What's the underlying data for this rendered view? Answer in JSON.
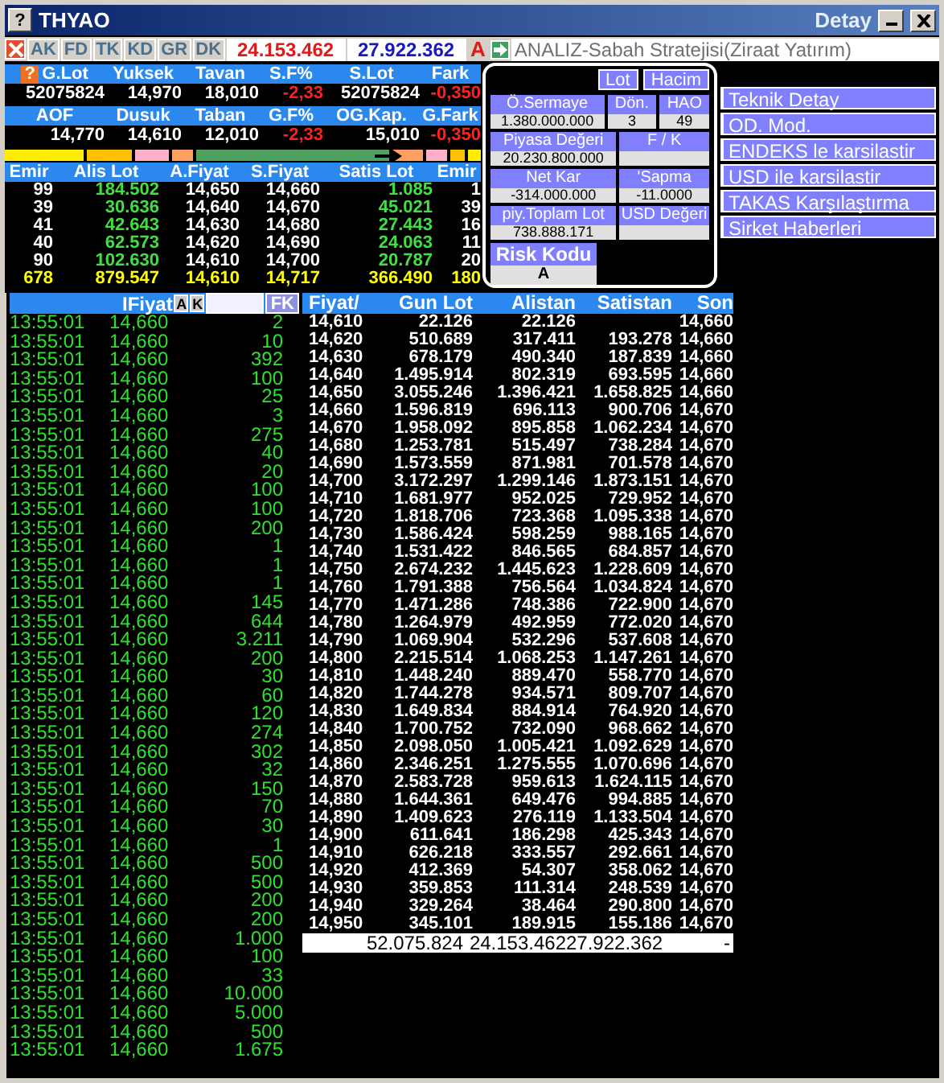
{
  "window": {
    "help": "?",
    "title": "THYAO",
    "caption": "Detay"
  },
  "summary_help": "?",
  "toolbar": {
    "tabs": [
      "AK",
      "FD",
      "TK",
      "KD",
      "GR",
      "DK"
    ],
    "bid_total": "24.153.462",
    "ask_total": "27.922.362",
    "flag": "A",
    "news": "ANALIZ-Sabah Stratejisi(Ziraat Yatırım)"
  },
  "summary": [
    {
      "labels": [
        "G.Lot",
        "Yuksek",
        "Tavan",
        "S.F%",
        "S.Lot",
        "Fark"
      ],
      "values": [
        {
          "text": "52075824",
          "negative": false
        },
        {
          "text": "14,970",
          "negative": false
        },
        {
          "text": "18,010",
          "negative": false
        },
        {
          "text": "-2,33",
          "negative": true
        },
        {
          "text": "52075824",
          "negative": false
        },
        {
          "text": "-0,350",
          "negative": true
        }
      ]
    },
    {
      "labels": [
        "AOF",
        "Dusuk",
        "Taban",
        "G.F%",
        "OG.Kap.",
        "G.Fark"
      ],
      "values": [
        {
          "text": "14,770",
          "negative": false
        },
        {
          "text": "14,610",
          "negative": false
        },
        {
          "text": "12,010",
          "negative": false
        },
        {
          "text": "-2,33",
          "negative": true
        },
        {
          "text": "15,010",
          "negative": false
        },
        {
          "text": "-0,350",
          "negative": true
        }
      ]
    }
  ],
  "depth": {
    "columns": [
      "Emir",
      "Alis Lot",
      "A.Fiyat",
      "S.Fiyat",
      "Satis Lot",
      "Emir"
    ],
    "rows": [
      [
        "99",
        "184.502",
        "14,650",
        "14,660",
        "1.085",
        "1"
      ],
      [
        "39",
        "30.636",
        "14,640",
        "14,670",
        "45.021",
        "39"
      ],
      [
        "41",
        "42.643",
        "14,630",
        "14,680",
        "27.443",
        "16"
      ],
      [
        "40",
        "62.573",
        "14,620",
        "14,690",
        "24.063",
        "11"
      ],
      [
        "90",
        "102.630",
        "14,610",
        "14,700",
        "20.787",
        "20"
      ]
    ],
    "total": [
      "678",
      "879.547",
      "14,610",
      "14,717",
      "366.490",
      "180"
    ]
  },
  "popup": {
    "units": [
      "Lot",
      "Hacim"
    ],
    "rows": [
      [
        {
          "label": "Ö.Sermaye",
          "value": "1.380.000.000"
        },
        {
          "label": "Dön.",
          "value": "3"
        },
        {
          "label": "HAO",
          "value": "49"
        }
      ],
      [
        {
          "label": "Piyasa Değeri",
          "value": "20.230.800.000"
        },
        {
          "label": "F / K"
        }
      ],
      [
        {
          "label": "Net Kar",
          "value": "-314.000.000"
        },
        {
          "label": "'Sapma",
          "value": "-11.0000"
        }
      ],
      [
        {
          "label": "piy.Toplam Lot",
          "value": "738.888.171"
        },
        {
          "label": "USD Değeri"
        }
      ]
    ],
    "risk": {
      "label": "Risk Kodu",
      "value": "A"
    }
  },
  "menu": [
    "Teknik Detay",
    "OD. Mod.",
    "ENDEKS le karsilastir",
    "USD ile karsilastir",
    "TAKAS Karşılaştırma",
    "Sirket Haberleri"
  ],
  "trades": {
    "header": {
      "label": "IFiyat",
      "buttons": [
        "A",
        "K"
      ],
      "filter": "FK"
    },
    "rows": [
      [
        "13:55:01",
        "14,660",
        "2"
      ],
      [
        "13:55:01",
        "14,660",
        "10"
      ],
      [
        "13:55:01",
        "14,660",
        "392"
      ],
      [
        "13:55:01",
        "14,660",
        "100"
      ],
      [
        "13:55:01",
        "14,660",
        "25"
      ],
      [
        "13:55:01",
        "14,660",
        "3"
      ],
      [
        "13:55:01",
        "14,660",
        "275"
      ],
      [
        "13:55:01",
        "14,660",
        "40"
      ],
      [
        "13:55:01",
        "14,660",
        "20"
      ],
      [
        "13:55:01",
        "14,660",
        "100"
      ],
      [
        "13:55:01",
        "14,660",
        "100"
      ],
      [
        "13:55:01",
        "14,660",
        "200"
      ],
      [
        "13:55:01",
        "14,660",
        "1"
      ],
      [
        "13:55:01",
        "14,660",
        "1"
      ],
      [
        "13:55:01",
        "14,660",
        "1"
      ],
      [
        "13:55:01",
        "14,660",
        "145"
      ],
      [
        "13:55:01",
        "14,660",
        "644"
      ],
      [
        "13:55:01",
        "14,660",
        "3.211"
      ],
      [
        "13:55:01",
        "14,660",
        "200"
      ],
      [
        "13:55:01",
        "14,660",
        "30"
      ],
      [
        "13:55:01",
        "14,660",
        "60"
      ],
      [
        "13:55:01",
        "14,660",
        "120"
      ],
      [
        "13:55:01",
        "14,660",
        "274"
      ],
      [
        "13:55:01",
        "14,660",
        "302"
      ],
      [
        "13:55:01",
        "14,660",
        "32"
      ],
      [
        "13:55:01",
        "14,660",
        "150"
      ],
      [
        "13:55:01",
        "14,660",
        "70"
      ],
      [
        "13:55:01",
        "14,660",
        "30"
      ],
      [
        "13:55:01",
        "14,660",
        "1"
      ],
      [
        "13:55:01",
        "14,660",
        "500"
      ],
      [
        "13:55:01",
        "14,660",
        "500"
      ],
      [
        "13:55:01",
        "14,660",
        "200"
      ],
      [
        "13:55:01",
        "14,660",
        "200"
      ],
      [
        "13:55:01",
        "14,660",
        "1.000"
      ],
      [
        "13:55:01",
        "14,660",
        "100"
      ],
      [
        "13:55:01",
        "14,660",
        "33"
      ],
      [
        "13:55:01",
        "14,660",
        "10.000"
      ],
      [
        "13:55:01",
        "14,660",
        "5.000"
      ],
      [
        "13:55:01",
        "14,660",
        "500"
      ],
      [
        "13:55:01",
        "14,660",
        "1.675"
      ]
    ]
  },
  "price_table": {
    "columns": [
      "Fiyat/",
      "Gun Lot",
      "Alistan",
      "Satistan",
      "Son"
    ],
    "rows": [
      [
        "14,610",
        "22.126",
        "22.126",
        null,
        "14,660"
      ],
      [
        "14,620",
        "510.689",
        "317.411",
        "193.278",
        "14,660"
      ],
      [
        "14,630",
        "678.179",
        "490.340",
        "187.839",
        "14,660"
      ],
      [
        "14,640",
        "1.495.914",
        "802.319",
        "693.595",
        "14,660"
      ],
      [
        "14,650",
        "3.055.246",
        "1.396.421",
        "1.658.825",
        "14,660"
      ],
      [
        "14,660",
        "1.596.819",
        "696.113",
        "900.706",
        "14,670"
      ],
      [
        "14,670",
        "1.958.092",
        "895.858",
        "1.062.234",
        "14,670"
      ],
      [
        "14,680",
        "1.253.781",
        "515.497",
        "738.284",
        "14,670"
      ],
      [
        "14,690",
        "1.573.559",
        "871.981",
        "701.578",
        "14,670"
      ],
      [
        "14,700",
        "3.172.297",
        "1.299.146",
        "1.873.151",
        "14,670"
      ],
      [
        "14,710",
        "1.681.977",
        "952.025",
        "729.952",
        "14,670"
      ],
      [
        "14,720",
        "1.818.706",
        "723.368",
        "1.095.338",
        "14,670"
      ],
      [
        "14,730",
        "1.586.424",
        "598.259",
        "988.165",
        "14,670"
      ],
      [
        "14,740",
        "1.531.422",
        "846.565",
        "684.857",
        "14,670"
      ],
      [
        "14,750",
        "2.674.232",
        "1.445.623",
        "1.228.609",
        "14,670"
      ],
      [
        "14,760",
        "1.791.388",
        "756.564",
        "1.034.824",
        "14,670"
      ],
      [
        "14,770",
        "1.471.286",
        "748.386",
        "722.900",
        "14,670"
      ],
      [
        "14,780",
        "1.264.979",
        "492.959",
        "772.020",
        "14,670"
      ],
      [
        "14,790",
        "1.069.904",
        "532.296",
        "537.608",
        "14,670"
      ],
      [
        "14,800",
        "2.215.514",
        "1.068.253",
        "1.147.261",
        "14,670"
      ],
      [
        "14,810",
        "1.448.240",
        "889.470",
        "558.770",
        "14,670"
      ],
      [
        "14,820",
        "1.744.278",
        "934.571",
        "809.707",
        "14,670"
      ],
      [
        "14,830",
        "1.649.834",
        "884.914",
        "764.920",
        "14,670"
      ],
      [
        "14,840",
        "1.700.752",
        "732.090",
        "968.662",
        "14,670"
      ],
      [
        "14,850",
        "2.098.050",
        "1.005.421",
        "1.092.629",
        "14,670"
      ],
      [
        "14,860",
        "2.346.251",
        "1.275.555",
        "1.070.696",
        "14,670"
      ],
      [
        "14,870",
        "2.583.728",
        "959.613",
        "1.624.115",
        "14,670"
      ],
      [
        "14,880",
        "1.644.361",
        "649.476",
        "994.885",
        "14,670"
      ],
      [
        "14,890",
        "1.409.623",
        "276.119",
        "1.133.504",
        "14,670"
      ],
      [
        "14,900",
        "611.641",
        "186.298",
        "425.343",
        "14,670"
      ],
      [
        "14,910",
        "626.218",
        "333.557",
        "292.661",
        "14,670"
      ],
      [
        "14,920",
        "412.369",
        "54.307",
        "358.062",
        "14,670"
      ],
      [
        "14,930",
        "359.853",
        "111.314",
        "248.539",
        "14,670"
      ],
      [
        "14,940",
        "329.264",
        "38.464",
        "290.800",
        "14,670"
      ],
      [
        "14,950",
        "345.101",
        "189.915",
        "155.186",
        "14,670"
      ]
    ],
    "total": [
      "52.075.824",
      "24.153.462",
      "27.922.362",
      "-"
    ]
  }
}
